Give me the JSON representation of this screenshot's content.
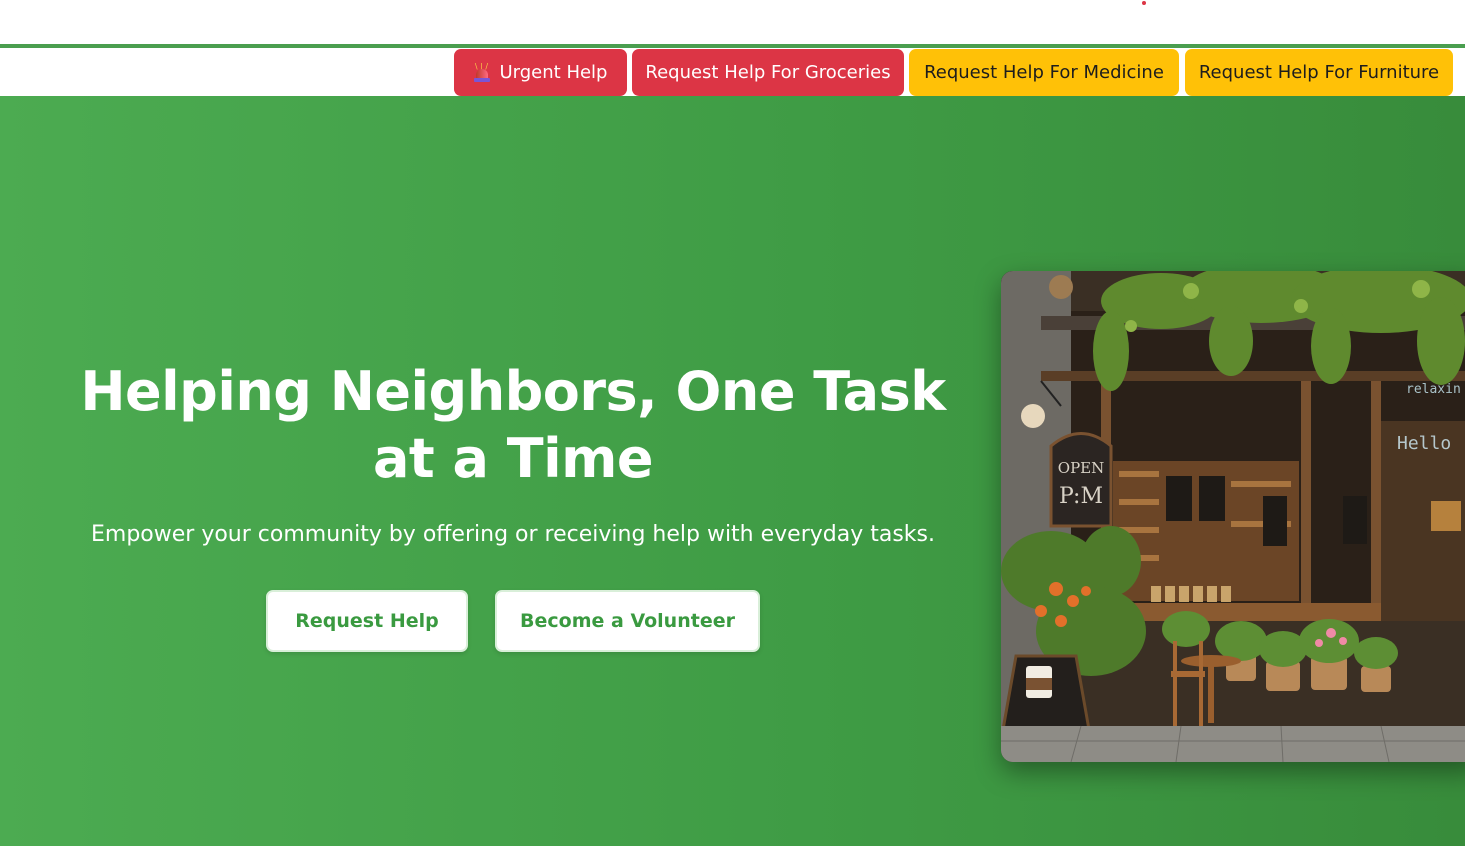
{
  "action_bar": {
    "urgent_label": "Urgent Help",
    "groceries_label": "Request Help For Groceries",
    "medicine_label": "Request Help For Medicine",
    "furniture_label": "Request Help For Furniture"
  },
  "hero": {
    "title": "Helping Neighbors, One Task at a Time",
    "subtitle": "Empower your community by offering or receiving help with everyday tasks.",
    "request_button": "Request Help",
    "volunteer_button": "Become a Volunteer"
  },
  "photo": {
    "sign_line1": "OPEN",
    "sign_line2": "P:M",
    "window_text1": "relaxin",
    "window_text2": "Hello"
  },
  "colors": {
    "brand_green": "#4a9e4f",
    "urgent_red": "#dc3545",
    "warning_yellow": "#ffc107"
  },
  "icons": {
    "urgent": "siren-icon"
  }
}
